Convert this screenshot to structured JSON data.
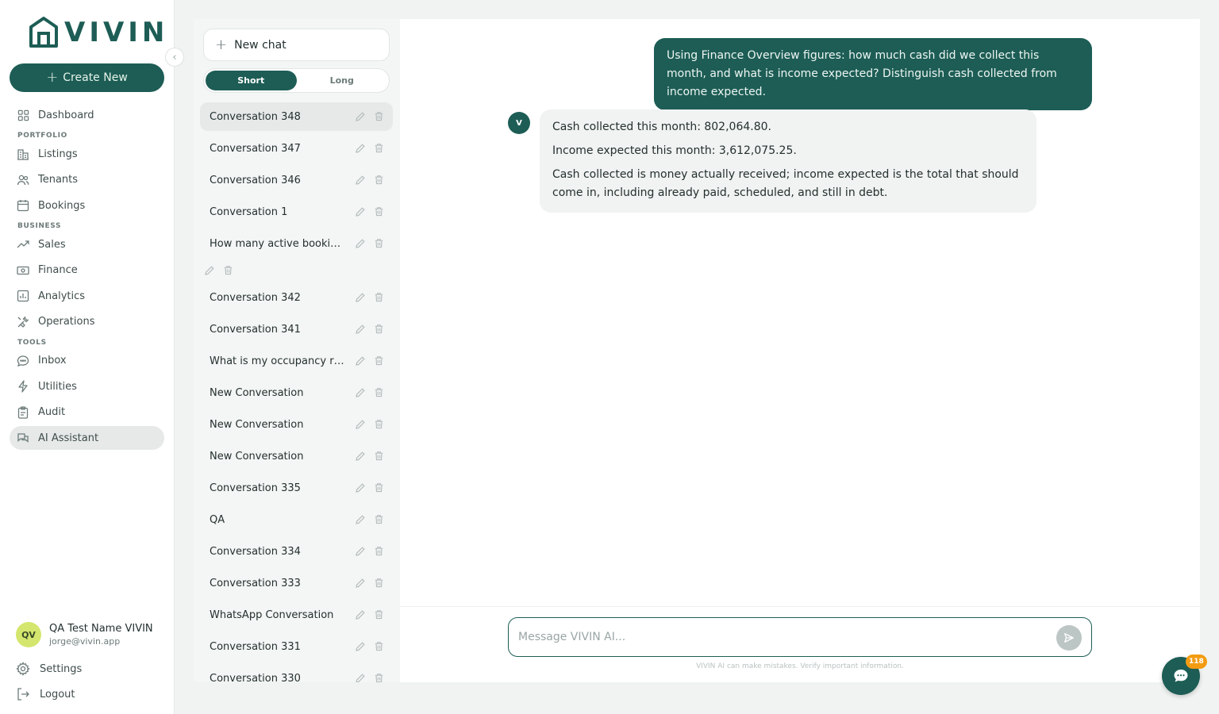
{
  "brand": {
    "name": "VIVIN"
  },
  "sidebar": {
    "create_label": "Create New",
    "items": [
      {
        "label": "Dashboard",
        "icon": "grid-icon"
      },
      {
        "section": "PORTFOLIO"
      },
      {
        "label": "Listings",
        "icon": "building-icon"
      },
      {
        "label": "Tenants",
        "icon": "users-icon"
      },
      {
        "label": "Bookings",
        "icon": "calendar-icon"
      },
      {
        "section": "BUSINESS"
      },
      {
        "label": "Sales",
        "icon": "trend-up-icon"
      },
      {
        "label": "Finance",
        "icon": "banknote-icon"
      },
      {
        "label": "Analytics",
        "icon": "bar-chart-icon"
      },
      {
        "label": "Operations",
        "icon": "tools-icon"
      },
      {
        "section": "TOOLS"
      },
      {
        "label": "Inbox",
        "icon": "message-icon"
      },
      {
        "label": "Utilities",
        "icon": "lightning-icon"
      },
      {
        "label": "Audit",
        "icon": "clipboard-icon"
      },
      {
        "label": "AI Assistant",
        "icon": "chat-bubbles-icon",
        "active": true
      }
    ],
    "user": {
      "initials": "QV",
      "name": "QA Test Name VIVIN",
      "email": "jorge@vivin.app"
    },
    "settings_label": "Settings",
    "logout_label": "Logout"
  },
  "conversations": {
    "new_chat_label": "New chat",
    "toggle": {
      "short": "Short",
      "long": "Long",
      "selected": "short"
    },
    "items": [
      {
        "title": "Conversation 348",
        "active": true
      },
      {
        "title": "Conversation 347"
      },
      {
        "title": "Conversation 346"
      },
      {
        "title": "Conversation 1"
      },
      {
        "title": "How many active bookings do I have?"
      },
      {
        "title": ""
      },
      {
        "title": "Conversation 342"
      },
      {
        "title": "Conversation 341"
      },
      {
        "title": "What is my occupancy rate?"
      },
      {
        "title": "New Conversation"
      },
      {
        "title": "New Conversation"
      },
      {
        "title": "New Conversation"
      },
      {
        "title": "Conversation 335"
      },
      {
        "title": "QA"
      },
      {
        "title": "Conversation 334"
      },
      {
        "title": "Conversation 333"
      },
      {
        "title": "WhatsApp Conversation"
      },
      {
        "title": "Conversation 331"
      },
      {
        "title": "Conversation 330"
      }
    ]
  },
  "chat": {
    "user_message": "Using Finance Overview figures: how much cash did we collect this month, and what is income expected? Distinguish cash collected from income expected.",
    "assistant_initial": "V",
    "assistant_paragraphs": [
      "Cash collected this month: 802,064.80.",
      "Income expected this month: 3,612,075.25.",
      "Cash collected is money actually received; income expected is the total that should come in, including already paid, scheduled, and still in debt."
    ],
    "input_placeholder": "Message VIVIN AI...",
    "input_value": "",
    "disclaimer": "VIVIN AI can make mistakes. Verify important information."
  },
  "fab": {
    "badge": "118"
  },
  "colors": {
    "brand": "#1d5d55",
    "badge": "#f39c12",
    "avatar": "#d4e66d"
  }
}
